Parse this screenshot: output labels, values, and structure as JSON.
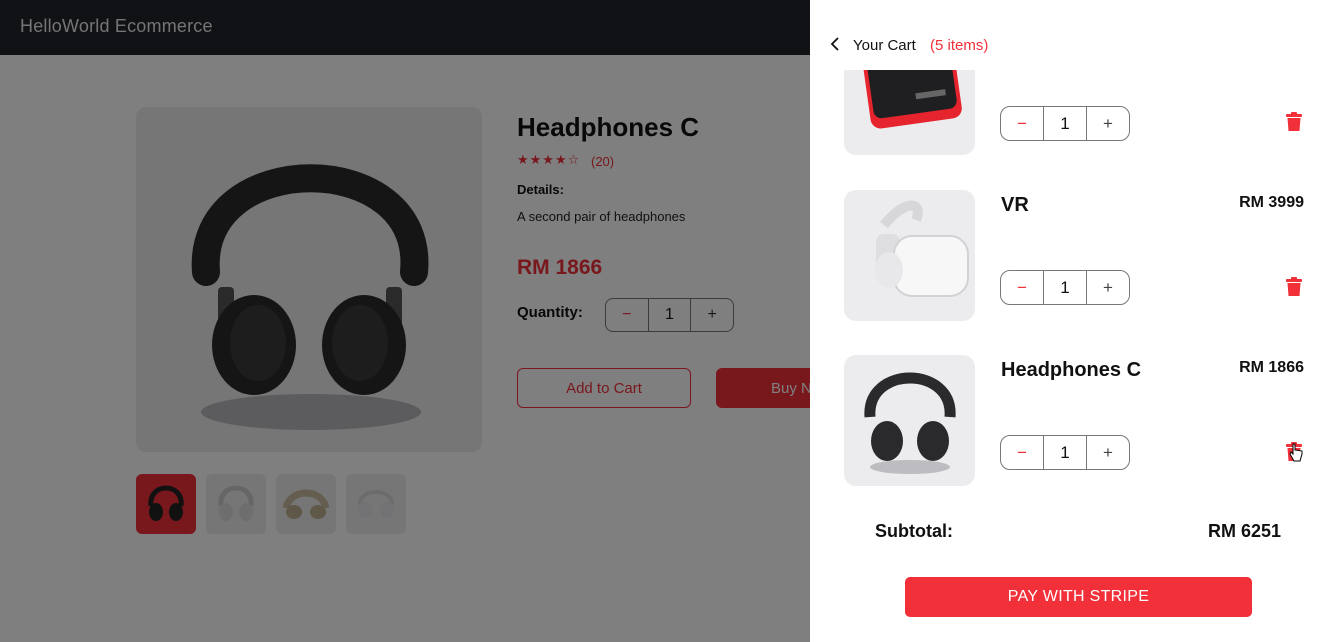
{
  "navbar": {
    "brand": "HelloWorld Ecommerce"
  },
  "product": {
    "title": "Headphones C",
    "stars": "★★★★☆",
    "reviews": "(20)",
    "details_heading": "Details:",
    "details": "A second pair of headphones",
    "price": "RM 1866",
    "quantity_label": "Quantity:",
    "quantity": "1",
    "add_to_cart": "Add to Cart",
    "buy_now": "Buy Now"
  },
  "cart": {
    "title": "Your Cart",
    "count": "(5 items)",
    "items": [
      {
        "name": "",
        "price": "",
        "quantity": "1",
        "image": "power-bank"
      },
      {
        "name": "VR",
        "price": "RM 3999",
        "quantity": "1",
        "image": "vr-headset"
      },
      {
        "name": "Headphones C",
        "price": "RM 1866",
        "quantity": "1",
        "image": "headphones"
      }
    ],
    "subtotal_label": "Subtotal:",
    "subtotal_value": "RM 6251",
    "pay_button": "PAY WITH STRIPE"
  },
  "colors": {
    "accent": "#f1303a",
    "navbar": "#23252b",
    "image_bg": "#ececee"
  },
  "icons": {
    "qty_minus": "−",
    "qty_plus": "+",
    "back": "chevron-left-icon",
    "delete": "trash-icon"
  }
}
